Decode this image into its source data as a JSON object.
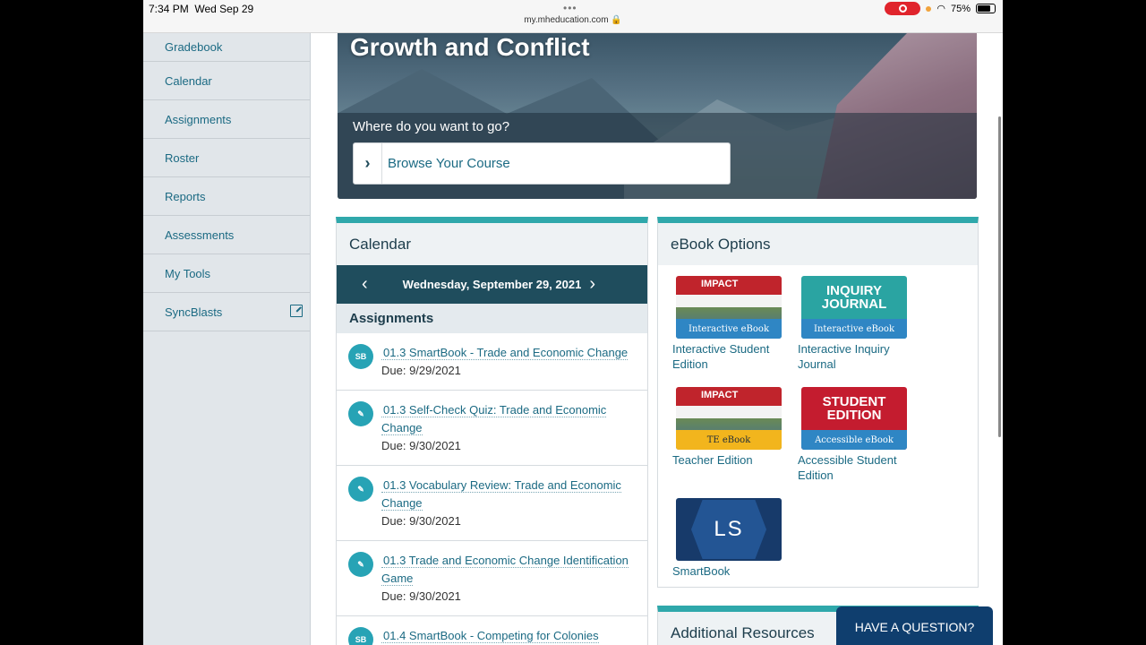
{
  "status_bar": {
    "time": "7:34 PM",
    "date": "Wed Sep 29",
    "url": "my.mheducation.com",
    "battery": "75%"
  },
  "sidebar": {
    "items": [
      {
        "label": "Gradebook"
      },
      {
        "label": "Calendar"
      },
      {
        "label": "Assignments"
      },
      {
        "label": "Roster"
      },
      {
        "label": "Reports"
      },
      {
        "label": "Assessments"
      },
      {
        "label": "My Tools"
      },
      {
        "label": "SyncBlasts"
      }
    ]
  },
  "hero": {
    "title": "Growth and Conflict",
    "question": "Where do you want to go?",
    "browse_label": "Browse Your Course"
  },
  "calendar": {
    "heading": "Calendar",
    "date": "Wednesday, September 29, 2021",
    "assignments_heading": "Assignments",
    "assignments": [
      {
        "icon": "SB",
        "title": "01.3 SmartBook - Trade and Economic Change",
        "due": "Due: 9/29/2021"
      },
      {
        "icon": "quiz",
        "title": "01.3 Self-Check Quiz: Trade and Economic Change",
        "due": "Due: 9/30/2021"
      },
      {
        "icon": "quiz",
        "title": "01.3 Vocabulary Review: Trade and Economic Change",
        "due": "Due: 9/30/2021"
      },
      {
        "icon": "quiz",
        "title": "01.3 Trade and Economic Change Identification Game",
        "due": "Due: 9/30/2021"
      },
      {
        "icon": "SB",
        "title": "01.4 SmartBook - Competing for Colonies",
        "due": ""
      }
    ]
  },
  "ebooks": {
    "heading": "eBook Options",
    "items": [
      {
        "label": "Interactive Student Edition",
        "cover_title": "IMPACT",
        "badge": "Interactive eBook"
      },
      {
        "label": "Interactive Inquiry Journal",
        "cover_title": "INQUIRY JOURNAL",
        "badge": "Interactive eBook"
      },
      {
        "label": "Teacher Edition",
        "cover_title": "IMPACT",
        "badge": "TE eBook"
      },
      {
        "label": "Accessible Student Edition",
        "cover_title": "STUDENT EDITION",
        "badge": "Accessible eBook"
      },
      {
        "label": "SmartBook",
        "cover_title": "LS",
        "badge": ""
      }
    ]
  },
  "additional": {
    "heading": "Additional Resources"
  },
  "help": {
    "label": "HAVE A QUESTION?"
  }
}
